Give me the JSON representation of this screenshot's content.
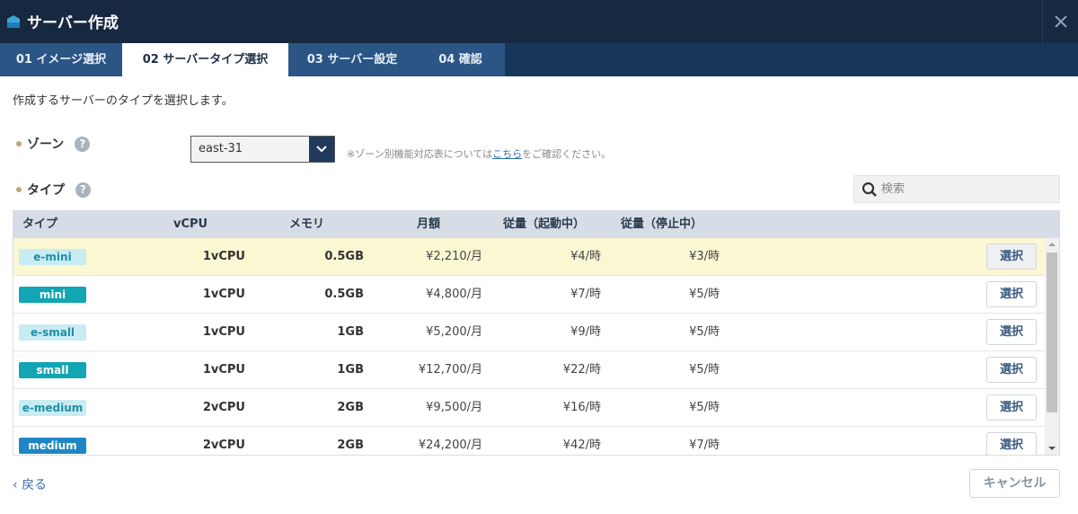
{
  "dialog": {
    "title": "サーバー作成"
  },
  "tabs": [
    {
      "label": "01 イメージ選択"
    },
    {
      "label": "02 サーバータイプ選択"
    },
    {
      "label": "03 サーバー設定"
    },
    {
      "label": "04 確認"
    }
  ],
  "active_tab": 1,
  "intro": "作成するサーバーのタイプを選択します。",
  "zone": {
    "label": "ゾーン",
    "help": "?",
    "value": "east-31",
    "note_prefix": "※ゾーン別機能対応表については",
    "note_link": "こちら",
    "note_suffix": "をご確認ください。"
  },
  "type": {
    "label": "タイプ",
    "help": "?"
  },
  "search": {
    "placeholder": "検索"
  },
  "table": {
    "headers": [
      "タイプ",
      "vCPU",
      "メモリ",
      "月額",
      "従量（起動中）",
      "従量（停止中）"
    ],
    "select_label": "選択",
    "rows": [
      {
        "type": "e-mini",
        "vcpu": "1vCPU",
        "memory": "0.5GB",
        "monthly": "¥2,210/月",
        "running": "¥4/時",
        "stopped": "¥3/時",
        "selected": true
      },
      {
        "type": "mini",
        "vcpu": "1vCPU",
        "memory": "0.5GB",
        "monthly": "¥4,800/月",
        "running": "¥7/時",
        "stopped": "¥5/時",
        "selected": false
      },
      {
        "type": "e-small",
        "vcpu": "1vCPU",
        "memory": "1GB",
        "monthly": "¥5,200/月",
        "running": "¥9/時",
        "stopped": "¥5/時",
        "selected": false
      },
      {
        "type": "small",
        "vcpu": "1vCPU",
        "memory": "1GB",
        "monthly": "¥12,700/月",
        "running": "¥22/時",
        "stopped": "¥5/時",
        "selected": false
      },
      {
        "type": "e-medium",
        "vcpu": "2vCPU",
        "memory": "2GB",
        "monthly": "¥9,500/月",
        "running": "¥16/時",
        "stopped": "¥5/時",
        "selected": false
      },
      {
        "type": "medium",
        "vcpu": "2vCPU",
        "memory": "2GB",
        "monthly": "¥24,200/月",
        "running": "¥42/時",
        "stopped": "¥7/時",
        "selected": false
      }
    ]
  },
  "colors": {
    "title_bar": "#172841",
    "tab_bar": "#2a5585",
    "badge_e_bg": "#c9ecf2",
    "badge_e_text": "#1f8fa6",
    "badge_std_bg": "#12a5b3",
    "badge_std_text": "#ffffff",
    "badge_medium_bg": "#1f86c4",
    "selected_row": "#fbf7d3"
  },
  "footer": {
    "back": "戻る",
    "cancel": "キャンセル"
  }
}
